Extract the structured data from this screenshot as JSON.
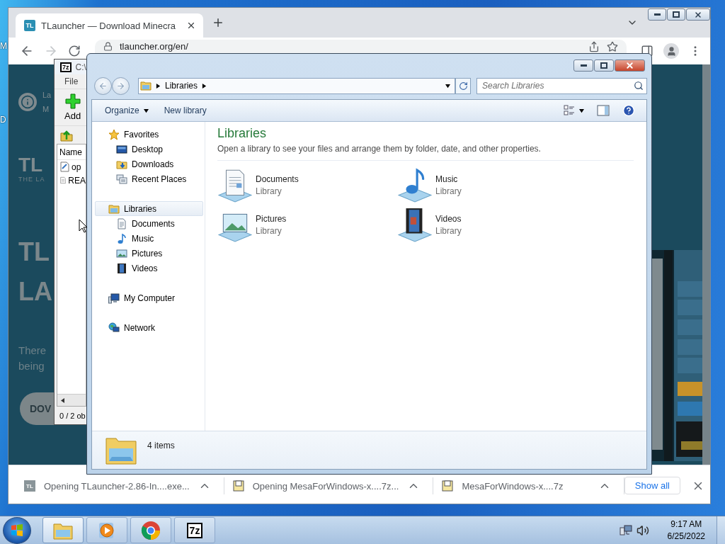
{
  "desktop": {
    "icon_labels": [
      "M",
      "D"
    ]
  },
  "browser": {
    "tabs": [
      {
        "badge": "TL",
        "title": "TLauncher — Download Minecra",
        "selected": true
      }
    ],
    "url": "tlauncher.org/en/",
    "page": {
      "notice_lines": [
        "La",
        "M"
      ],
      "logo": "TL",
      "tagline": "THE LA",
      "headline": [
        "TL",
        "LA"
      ],
      "body": [
        "There",
        "being"
      ],
      "download_button": "DOV"
    },
    "downloads": [
      {
        "kind": "tlauncher",
        "badge": "TL",
        "name": "Opening TLauncher-2.86-In....exe..."
      },
      {
        "kind": "archive",
        "name": "Opening MesaForWindows-x....7z..."
      },
      {
        "kind": "archive",
        "name": "MesaForWindows-x....7z"
      }
    ],
    "show_all": "Show all"
  },
  "archiver": {
    "logo": "7z",
    "title": "C:\\",
    "menu": [
      "File"
    ],
    "toolbar": [
      "Add"
    ],
    "columns": [
      "Name"
    ],
    "rows": [
      {
        "kind": "shortcut",
        "name": "op"
      },
      {
        "kind": "text",
        "name": "REA"
      }
    ],
    "status": "0 / 2 ob"
  },
  "explorer": {
    "path": [
      "Libraries"
    ],
    "search_placeholder": "Search Libraries",
    "commands": [
      {
        "kind": "menu",
        "label": "Organize"
      },
      {
        "kind": "button",
        "label": "New library"
      }
    ],
    "nav": [
      {
        "kind": "favorites",
        "label": "Favorites",
        "selected": false,
        "children": [
          {
            "kind": "desktop",
            "label": "Desktop",
            "selected": false
          },
          {
            "kind": "downloads",
            "label": "Downloads",
            "selected": false
          },
          {
            "kind": "recent",
            "label": "Recent Places",
            "selected": false
          }
        ]
      },
      {
        "kind": "libraries",
        "label": "Libraries",
        "selected": true,
        "children": [
          {
            "kind": "documents",
            "label": "Documents",
            "selected": false
          },
          {
            "kind": "music",
            "label": "Music",
            "selected": false
          },
          {
            "kind": "pictures",
            "label": "Pictures",
            "selected": false
          },
          {
            "kind": "videos",
            "label": "Videos",
            "selected": false
          }
        ]
      },
      {
        "kind": "computer",
        "label": "My Computer",
        "selected": false
      },
      {
        "kind": "network",
        "label": "Network",
        "selected": false
      }
    ],
    "heading": "Libraries",
    "description": "Open a library to see your files and arrange them by folder, date, and other properties.",
    "libraries": [
      {
        "kind": "documents",
        "name": "Documents",
        "type": "Library"
      },
      {
        "kind": "music",
        "name": "Music",
        "type": "Library"
      },
      {
        "kind": "pictures",
        "name": "Pictures",
        "type": "Library"
      },
      {
        "kind": "videos",
        "name": "Videos",
        "type": "Library"
      }
    ],
    "status": "4 items"
  },
  "taskbar": {
    "items": [
      {
        "kind": "explorer",
        "selected": true
      },
      {
        "kind": "media",
        "selected": false
      },
      {
        "kind": "chrome",
        "selected": false
      },
      {
        "kind": "archiver",
        "text": "7z",
        "selected": false
      }
    ],
    "clock": {
      "time": "9:17 AM",
      "date": "6/25/2022"
    }
  }
}
